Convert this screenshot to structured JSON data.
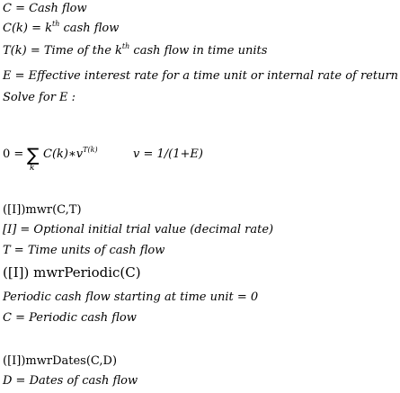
{
  "lines": {
    "l1": "C = Cash flow",
    "l2a": "C(k) = k",
    "l2sup": "th",
    "l2b": "cash flow",
    "l3a": "T(k) = Time of the k",
    "l3sup": "th",
    "l3b": "cash flow in time units",
    "l4": "E = Effective interest rate for a time unit or internal rate of return",
    "l5": "Solve for E :",
    "eq_lhs": "0 =",
    "eq_sum": "∑",
    "eq_sub": "k",
    "eq_term": "C(k)∗v",
    "eq_exp": "T(k)",
    "eq_v": "v = 1/(1+E)",
    "f1": "([I])mwr(C,T)",
    "f1a": "[I] = Optional initial trial value (decimal rate)",
    "f1b": "T = Time units of cash flow",
    "f2": "([I]) mwrPeriodic(C)",
    "f2a": "Periodic cash flow starting at time unit  =  0",
    "f2b": "C = Periodic cash flow",
    "f3": "([I])mwrDates(C,D)",
    "f3a": "D = Dates of cash flow"
  }
}
